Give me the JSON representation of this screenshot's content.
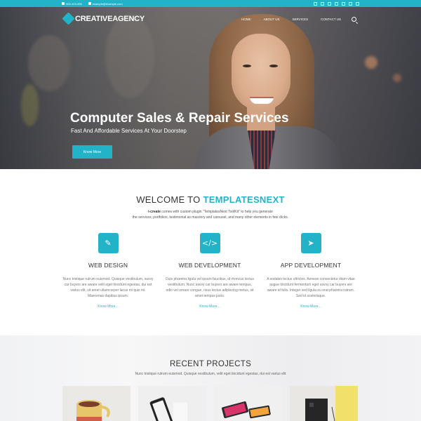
{
  "topbar": {
    "phone": "000-123-456",
    "email": "example@example.com",
    "socials": [
      "twitter-icon",
      "facebook-icon",
      "linkedin-icon",
      "pinterest-icon",
      "flickr-icon",
      "email-icon",
      "instagram-icon"
    ]
  },
  "header": {
    "logo_text": "CREATIVEAGENCY",
    "nav": [
      "HOME",
      "ABOUT US",
      "SERVICES",
      "CONTACT US"
    ]
  },
  "hero": {
    "title": "Computer Sales & Repair Services",
    "subtitle": "Fast And Affordable Services At Your Doorstep",
    "button": "Know More"
  },
  "welcome": {
    "title_prefix": "WELCOME TO ",
    "title_accent": "TEMPLATESNEXT",
    "brand": "i-create",
    "desc_line1": " comes with custom plugin \"TemplatesNext ToolKit\" to help you generate",
    "desc_line2": "the services, portfolios, testimonial as masonry and carousel, and many other elements in few clicks."
  },
  "services": [
    {
      "icon": "magic-wand-icon",
      "title": "WEB DESIGN",
      "desc": "Nunc tristique rutrum euismod. Quisque vestibulum, savvy car buyers are aware velit eget tincidunt egestas, dui est varius elit, sit amet ullamcorper lacus mi quis mi. Maecenas dapibus ipsum.",
      "more": "Know More..."
    },
    {
      "icon": "code-icon",
      "title": "WEB DEVELOPMENT",
      "desc": "Duis pharetra ligula vel ipsum faucibus, id rhoncus lectus vestibulum. Nunc savvy car buyers are aware tempus, odio vel ornare congue, risus lectus adipiscing metus, sit amet tempus justo.",
      "more": "Know More..."
    },
    {
      "icon": "paper-plane-icon",
      "title": "APP DEVELOPMENT",
      "desc": "A sodales lectus ultricies. Aenean consectetur diam vitae augue tincidunt fermentum eget savvy car buyers are aware id felis. Integer sed ligula eu erat pharetra rutrum. Sed id scelerisque.",
      "more": "Know More..."
    }
  ],
  "projects": {
    "title": "RECENT PROJECTS",
    "desc": "Nunc tristique rutrum euismod. Quisque vestibulum, velit eget tincidunt egestas, dui est varius elit"
  },
  "colors": {
    "accent": "#23b3c9"
  }
}
